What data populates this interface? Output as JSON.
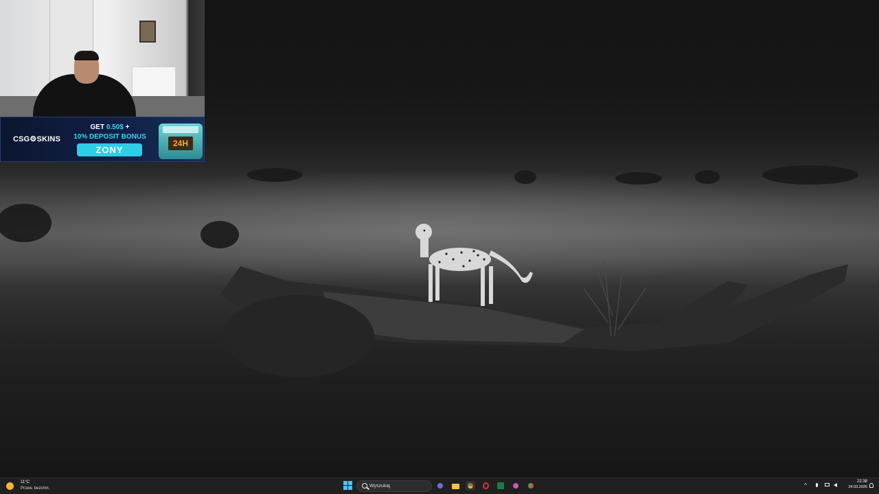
{
  "overlay": {
    "banner": {
      "brand": "CSG⚙SKINS",
      "line1_prefix": "GET ",
      "line1_amount": "0.50$",
      "line1_suffix": " +",
      "line2": "10% DEPOSIT BONUS",
      "code": "ZONY",
      "crate_label": "24H"
    }
  },
  "taskbar": {
    "weather": {
      "temp": "11°C",
      "desc": "Przew. bezchm.",
      "icon": "sun-icon"
    },
    "search": {
      "placeholder": "Wyszukaj"
    },
    "apps": [
      {
        "name": "start-icon"
      },
      {
        "name": "teams-icon"
      },
      {
        "name": "file-explorer-icon"
      },
      {
        "name": "chrome-icon"
      },
      {
        "name": "opera-icon"
      },
      {
        "name": "excel-icon"
      },
      {
        "name": "messenger-icon"
      },
      {
        "name": "chrome-alt-icon"
      }
    ],
    "tray": {
      "chevron": "^",
      "time": "22:38",
      "date": "24.03.2026"
    }
  },
  "colors": {
    "taskbar_bg": "#202020",
    "banner_accent": "#2ecde8",
    "start_blue": "#4cc2ff"
  }
}
